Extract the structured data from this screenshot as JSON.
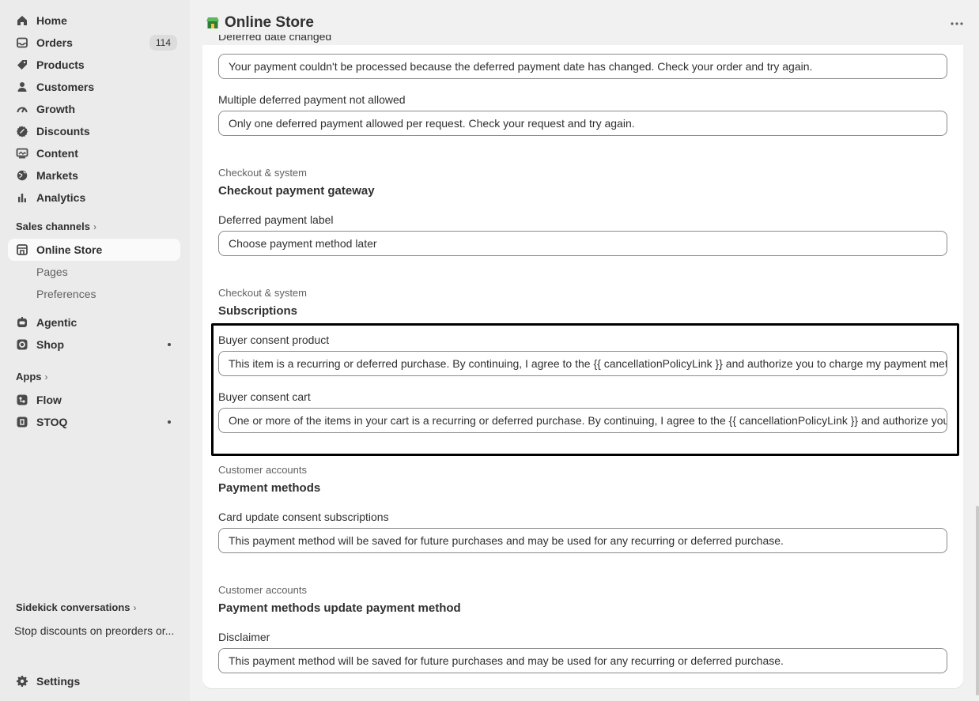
{
  "sidebar": {
    "items": [
      {
        "label": "Home",
        "icon": "home-icon"
      },
      {
        "label": "Orders",
        "icon": "inbox-icon",
        "badge": "114"
      },
      {
        "label": "Products",
        "icon": "tag-icon"
      },
      {
        "label": "Customers",
        "icon": "person-icon"
      },
      {
        "label": "Growth",
        "icon": "gauge-icon"
      },
      {
        "label": "Discounts",
        "icon": "discount-icon"
      },
      {
        "label": "Content",
        "icon": "image-icon"
      },
      {
        "label": "Markets",
        "icon": "globe-icon"
      },
      {
        "label": "Analytics",
        "icon": "bar-chart-icon"
      }
    ],
    "sales_channels_label": "Sales channels",
    "online_store": {
      "label": "Online Store",
      "sub": [
        "Pages",
        "Preferences"
      ]
    },
    "channels": [
      {
        "label": "Agentic"
      },
      {
        "label": "Shop"
      }
    ],
    "apps_label": "Apps",
    "apps": [
      {
        "label": "Flow"
      },
      {
        "label": "STOQ"
      }
    ],
    "sidekick_label": "Sidekick conversations",
    "sidekick_item": "Stop discounts on preorders or...",
    "settings_label": "Settings"
  },
  "header": {
    "title": "Online Store"
  },
  "form": {
    "top_cut_label": "Deferred date changed",
    "deferred_date_value": "Your payment couldn't be processed because the deferred payment date has changed. Check your order and try again.",
    "multiple_label": "Multiple deferred payment not allowed",
    "multiple_value": "Only one deferred payment allowed per request. Check your request and try again.",
    "gateway_cat": "Checkout & system",
    "gateway_title": "Checkout payment gateway",
    "deferred_label": "Deferred payment label",
    "deferred_value": "Choose payment method later",
    "subs_cat": "Checkout & system",
    "subs_title": "Subscriptions",
    "consent_product_label": "Buyer consent product",
    "consent_product_value": "This item is a recurring or deferred purchase. By continuing, I agree to the {{ cancellationPolicyLink }} and authorize you to charge my payment method",
    "consent_cart_label": "Buyer consent cart",
    "consent_cart_value": "One or more of the items in your cart is a recurring or deferred purchase. By continuing, I agree to the {{ cancellationPolicyLink }} and authorize you",
    "pm_cat": "Customer accounts",
    "pm_title": "Payment methods",
    "card_update_label": "Card update consent subscriptions",
    "card_update_value": "This payment method will be saved for future purchases and may be used for any recurring or deferred purchase.",
    "pmu_cat": "Customer accounts",
    "pmu_title": "Payment methods update payment method",
    "disclaimer_label": "Disclaimer",
    "disclaimer_value": "This payment method will be saved for future purchases and may be used for any recurring or deferred purchase."
  }
}
